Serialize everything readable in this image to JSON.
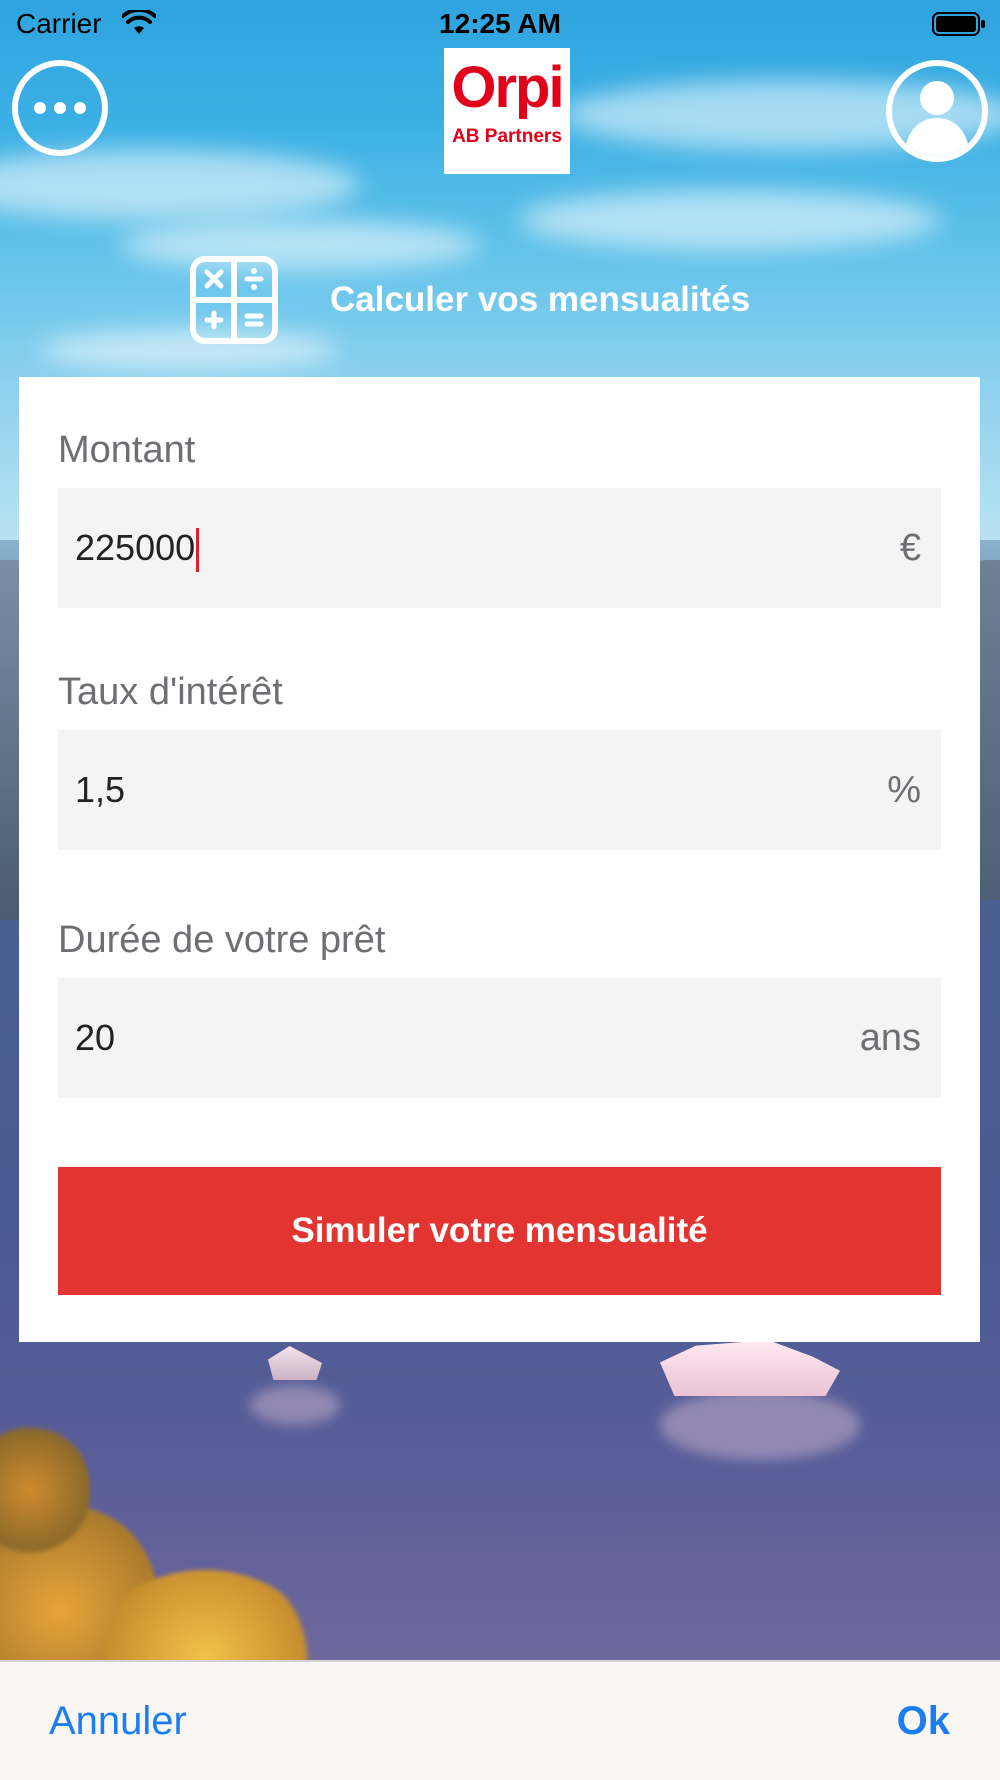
{
  "status_bar": {
    "carrier": "Carrier",
    "time": "12:25 AM",
    "wifi_icon": "wifi-icon",
    "battery_icon": "battery-icon"
  },
  "header": {
    "logo_word": "Orpi",
    "logo_subtitle": "AB Partners",
    "menu_icon": "more-dots-icon",
    "profile_icon": "user-avatar-icon"
  },
  "page": {
    "title": "Calculer vos mensualités",
    "title_icon": "calculator-icon"
  },
  "form": {
    "amount": {
      "label": "Montant",
      "value": "225000",
      "unit": "€"
    },
    "rate": {
      "label": "Taux d'intérêt",
      "value": "1,5",
      "unit": "%"
    },
    "duration": {
      "label": "Durée de votre prêt",
      "value": "20",
      "unit": "ans"
    },
    "submit_label": "Simuler votre mensualité"
  },
  "toolbar": {
    "cancel_label": "Annuler",
    "ok_label": "Ok"
  },
  "colors": {
    "brand_red": "#e2001a",
    "button_red": "#e23430",
    "ios_blue": "#1a7ef2",
    "cursor": "#d8232a"
  }
}
